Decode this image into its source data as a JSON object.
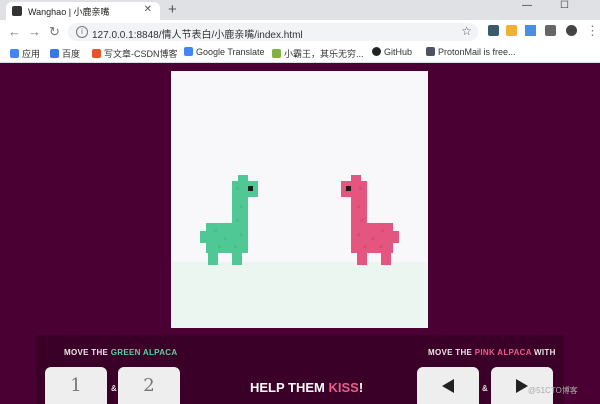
{
  "browser": {
    "tab_title": "Wanghao | 小鹿亲嘴",
    "url": "127.0.0.1:8848/情人节表白/小鹿亲嘴/index.html",
    "bookmarks": [
      "应用",
      "百度",
      "写文章-CSDN博客",
      "Google Translate",
      "小霸王，其乐无穷...",
      "GitHub",
      "ProtonMail is free..."
    ]
  },
  "controls": {
    "green_prefix": "MOVE THE",
    "green_name": "GREEN ALPACA",
    "pink_prefix": "MOVE THE",
    "pink_name": "PINK ALPACA",
    "pink_suffix": "WITH",
    "key1": "1",
    "key2": "2",
    "amp": "&",
    "help_prefix": "HELP THEM",
    "help_word": "KISS",
    "help_suffix": "!"
  },
  "watermark": "@51CTO博客",
  "colors": {
    "green": "#4fc896",
    "pink": "#e4557f",
    "background": "#4a0033"
  }
}
